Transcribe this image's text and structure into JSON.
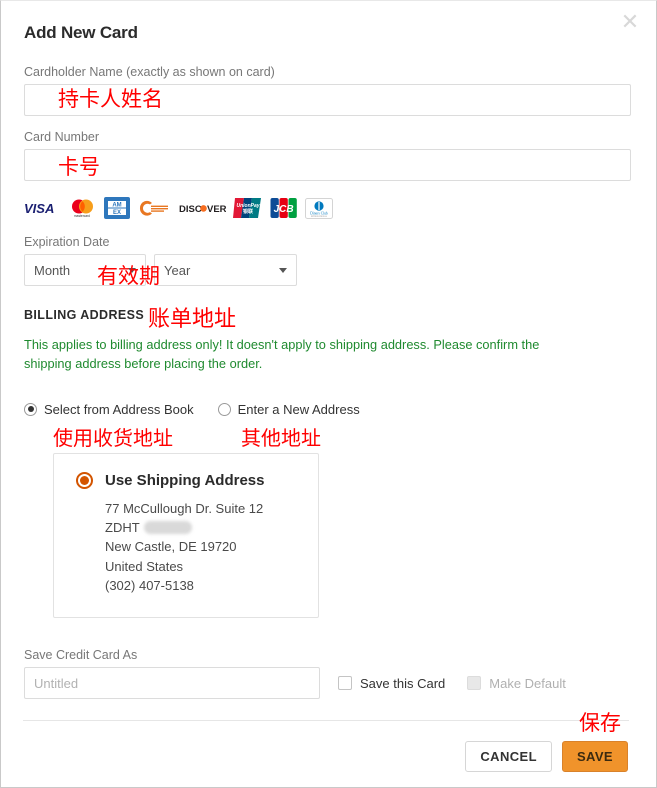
{
  "dialog": {
    "title": "Add New Card",
    "close_icon": "close-icon"
  },
  "fields": {
    "cardholder": {
      "label": "Cardholder Name (exactly as shown on card)",
      "value": "",
      "placeholder": "",
      "annotation": "持卡人姓名"
    },
    "card_number": {
      "label": "Card Number",
      "value": "",
      "placeholder": "",
      "annotation": "卡号"
    },
    "expiration": {
      "label": "Expiration Date",
      "month_value": "Month",
      "year_value": "Year",
      "annotation": "有效期"
    }
  },
  "card_brands": [
    {
      "name": "visa-logo",
      "label": "VISA"
    },
    {
      "name": "mastercard-logo",
      "label": "mastercard"
    },
    {
      "name": "amex-logo",
      "label": "AMEX"
    },
    {
      "name": "maestro-logo",
      "label": "Maestro"
    },
    {
      "name": "discover-logo",
      "label": "DISCOVER"
    },
    {
      "name": "unionpay-logo",
      "label": "UnionPay"
    },
    {
      "name": "jcb-logo",
      "label": "JCB"
    },
    {
      "name": "diners-club-logo",
      "label": "Diners Club"
    }
  ],
  "billing": {
    "heading": "BILLING ADDRESS",
    "heading_annotation": "账单地址",
    "note": "This applies to billing address only! It doesn't apply to shipping address. Please confirm the shipping address before placing the order.",
    "note_color": "#1f8a2f",
    "options": [
      {
        "label": "Select from Address Book",
        "selected": true,
        "annotation": "使用收货地址"
      },
      {
        "label": "Enter a New Address",
        "selected": false,
        "annotation": "其他地址"
      }
    ],
    "address_card": {
      "title": "Use Shipping Address",
      "selected": true,
      "accent_color": "#d35400",
      "lines": [
        "77 McCullough Dr. Suite 12",
        "ZDHT",
        "New Castle, DE 19720",
        "United States",
        "(302) 407-5138"
      ],
      "redacted_line_index": 1
    }
  },
  "save_card": {
    "label": "Save Credit Card As",
    "input_value": "",
    "input_placeholder": "Untitled",
    "save_this_card_label": "Save this Card",
    "save_this_card_checked": false,
    "make_default_label": "Make Default",
    "make_default_checked": false,
    "make_default_disabled": true
  },
  "footer": {
    "cancel_label": "CANCEL",
    "save_label": "SAVE",
    "save_annotation": "保存",
    "save_color": "#f0932b"
  }
}
